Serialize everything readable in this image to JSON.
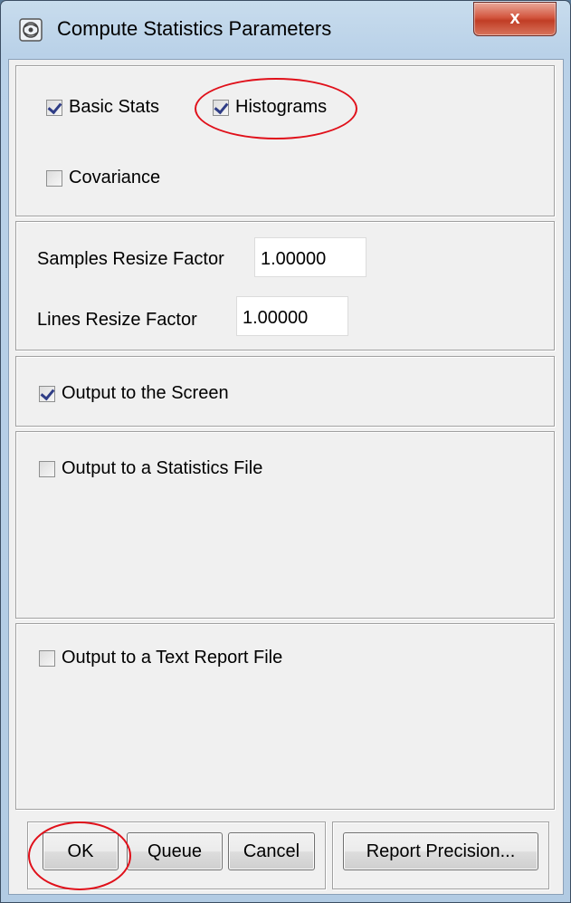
{
  "window": {
    "title": "Compute Statistics Parameters",
    "close_label": "x"
  },
  "stats": {
    "basic_stats": {
      "label": "Basic Stats",
      "checked": true
    },
    "histograms": {
      "label": "Histograms",
      "checked": true
    },
    "covariance": {
      "label": "Covariance",
      "checked": false
    }
  },
  "resize": {
    "samples_label": "Samples Resize Factor",
    "samples_value": "1.00000",
    "lines_label": "Lines Resize Factor",
    "lines_value": "1.00000"
  },
  "output": {
    "screen": {
      "label": "Output to the Screen",
      "checked": true
    },
    "stats_file": {
      "label": "Output to a Statistics File",
      "checked": false
    },
    "text_report": {
      "label": "Output to a Text Report File",
      "checked": false
    }
  },
  "buttons": {
    "ok": "OK",
    "queue": "Queue",
    "cancel": "Cancel",
    "report_precision": "Report Precision..."
  },
  "annotations": {
    "color": "#e0101a",
    "circled": [
      "Histograms",
      "OK"
    ]
  }
}
